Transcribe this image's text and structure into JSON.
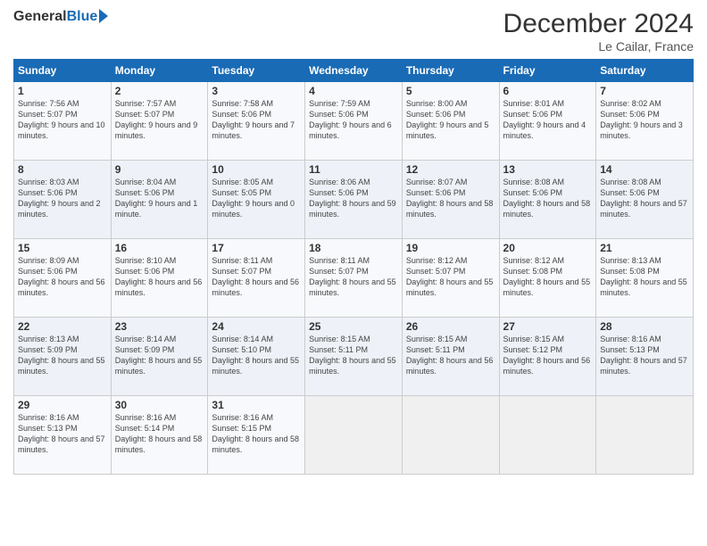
{
  "header": {
    "logo_general": "General",
    "logo_blue": "Blue",
    "main_title": "December 2024",
    "subtitle": "Le Cailar, France"
  },
  "calendar": {
    "days_of_week": [
      "Sunday",
      "Monday",
      "Tuesday",
      "Wednesday",
      "Thursday",
      "Friday",
      "Saturday"
    ],
    "weeks": [
      [
        {
          "day": "1",
          "sunrise": "Sunrise: 7:56 AM",
          "sunset": "Sunset: 5:07 PM",
          "daylight": "Daylight: 9 hours and 10 minutes."
        },
        {
          "day": "2",
          "sunrise": "Sunrise: 7:57 AM",
          "sunset": "Sunset: 5:07 PM",
          "daylight": "Daylight: 9 hours and 9 minutes."
        },
        {
          "day": "3",
          "sunrise": "Sunrise: 7:58 AM",
          "sunset": "Sunset: 5:06 PM",
          "daylight": "Daylight: 9 hours and 7 minutes."
        },
        {
          "day": "4",
          "sunrise": "Sunrise: 7:59 AM",
          "sunset": "Sunset: 5:06 PM",
          "daylight": "Daylight: 9 hours and 6 minutes."
        },
        {
          "day": "5",
          "sunrise": "Sunrise: 8:00 AM",
          "sunset": "Sunset: 5:06 PM",
          "daylight": "Daylight: 9 hours and 5 minutes."
        },
        {
          "day": "6",
          "sunrise": "Sunrise: 8:01 AM",
          "sunset": "Sunset: 5:06 PM",
          "daylight": "Daylight: 9 hours and 4 minutes."
        },
        {
          "day": "7",
          "sunrise": "Sunrise: 8:02 AM",
          "sunset": "Sunset: 5:06 PM",
          "daylight": "Daylight: 9 hours and 3 minutes."
        }
      ],
      [
        {
          "day": "8",
          "sunrise": "Sunrise: 8:03 AM",
          "sunset": "Sunset: 5:06 PM",
          "daylight": "Daylight: 9 hours and 2 minutes."
        },
        {
          "day": "9",
          "sunrise": "Sunrise: 8:04 AM",
          "sunset": "Sunset: 5:06 PM",
          "daylight": "Daylight: 9 hours and 1 minute."
        },
        {
          "day": "10",
          "sunrise": "Sunrise: 8:05 AM",
          "sunset": "Sunset: 5:05 PM",
          "daylight": "Daylight: 9 hours and 0 minutes."
        },
        {
          "day": "11",
          "sunrise": "Sunrise: 8:06 AM",
          "sunset": "Sunset: 5:06 PM",
          "daylight": "Daylight: 8 hours and 59 minutes."
        },
        {
          "day": "12",
          "sunrise": "Sunrise: 8:07 AM",
          "sunset": "Sunset: 5:06 PM",
          "daylight": "Daylight: 8 hours and 58 minutes."
        },
        {
          "day": "13",
          "sunrise": "Sunrise: 8:08 AM",
          "sunset": "Sunset: 5:06 PM",
          "daylight": "Daylight: 8 hours and 58 minutes."
        },
        {
          "day": "14",
          "sunrise": "Sunrise: 8:08 AM",
          "sunset": "Sunset: 5:06 PM",
          "daylight": "Daylight: 8 hours and 57 minutes."
        }
      ],
      [
        {
          "day": "15",
          "sunrise": "Sunrise: 8:09 AM",
          "sunset": "Sunset: 5:06 PM",
          "daylight": "Daylight: 8 hours and 56 minutes."
        },
        {
          "day": "16",
          "sunrise": "Sunrise: 8:10 AM",
          "sunset": "Sunset: 5:06 PM",
          "daylight": "Daylight: 8 hours and 56 minutes."
        },
        {
          "day": "17",
          "sunrise": "Sunrise: 8:11 AM",
          "sunset": "Sunset: 5:07 PM",
          "daylight": "Daylight: 8 hours and 56 minutes."
        },
        {
          "day": "18",
          "sunrise": "Sunrise: 8:11 AM",
          "sunset": "Sunset: 5:07 PM",
          "daylight": "Daylight: 8 hours and 55 minutes."
        },
        {
          "day": "19",
          "sunrise": "Sunrise: 8:12 AM",
          "sunset": "Sunset: 5:07 PM",
          "daylight": "Daylight: 8 hours and 55 minutes."
        },
        {
          "day": "20",
          "sunrise": "Sunrise: 8:12 AM",
          "sunset": "Sunset: 5:08 PM",
          "daylight": "Daylight: 8 hours and 55 minutes."
        },
        {
          "day": "21",
          "sunrise": "Sunrise: 8:13 AM",
          "sunset": "Sunset: 5:08 PM",
          "daylight": "Daylight: 8 hours and 55 minutes."
        }
      ],
      [
        {
          "day": "22",
          "sunrise": "Sunrise: 8:13 AM",
          "sunset": "Sunset: 5:09 PM",
          "daylight": "Daylight: 8 hours and 55 minutes."
        },
        {
          "day": "23",
          "sunrise": "Sunrise: 8:14 AM",
          "sunset": "Sunset: 5:09 PM",
          "daylight": "Daylight: 8 hours and 55 minutes."
        },
        {
          "day": "24",
          "sunrise": "Sunrise: 8:14 AM",
          "sunset": "Sunset: 5:10 PM",
          "daylight": "Daylight: 8 hours and 55 minutes."
        },
        {
          "day": "25",
          "sunrise": "Sunrise: 8:15 AM",
          "sunset": "Sunset: 5:11 PM",
          "daylight": "Daylight: 8 hours and 55 minutes."
        },
        {
          "day": "26",
          "sunrise": "Sunrise: 8:15 AM",
          "sunset": "Sunset: 5:11 PM",
          "daylight": "Daylight: 8 hours and 56 minutes."
        },
        {
          "day": "27",
          "sunrise": "Sunrise: 8:15 AM",
          "sunset": "Sunset: 5:12 PM",
          "daylight": "Daylight: 8 hours and 56 minutes."
        },
        {
          "day": "28",
          "sunrise": "Sunrise: 8:16 AM",
          "sunset": "Sunset: 5:13 PM",
          "daylight": "Daylight: 8 hours and 57 minutes."
        }
      ],
      [
        {
          "day": "29",
          "sunrise": "Sunrise: 8:16 AM",
          "sunset": "Sunset: 5:13 PM",
          "daylight": "Daylight: 8 hours and 57 minutes."
        },
        {
          "day": "30",
          "sunrise": "Sunrise: 8:16 AM",
          "sunset": "Sunset: 5:14 PM",
          "daylight": "Daylight: 8 hours and 58 minutes."
        },
        {
          "day": "31",
          "sunrise": "Sunrise: 8:16 AM",
          "sunset": "Sunset: 5:15 PM",
          "daylight": "Daylight: 8 hours and 58 minutes."
        },
        {
          "day": "",
          "sunrise": "",
          "sunset": "",
          "daylight": ""
        },
        {
          "day": "",
          "sunrise": "",
          "sunset": "",
          "daylight": ""
        },
        {
          "day": "",
          "sunrise": "",
          "sunset": "",
          "daylight": ""
        },
        {
          "day": "",
          "sunrise": "",
          "sunset": "",
          "daylight": ""
        }
      ]
    ]
  }
}
